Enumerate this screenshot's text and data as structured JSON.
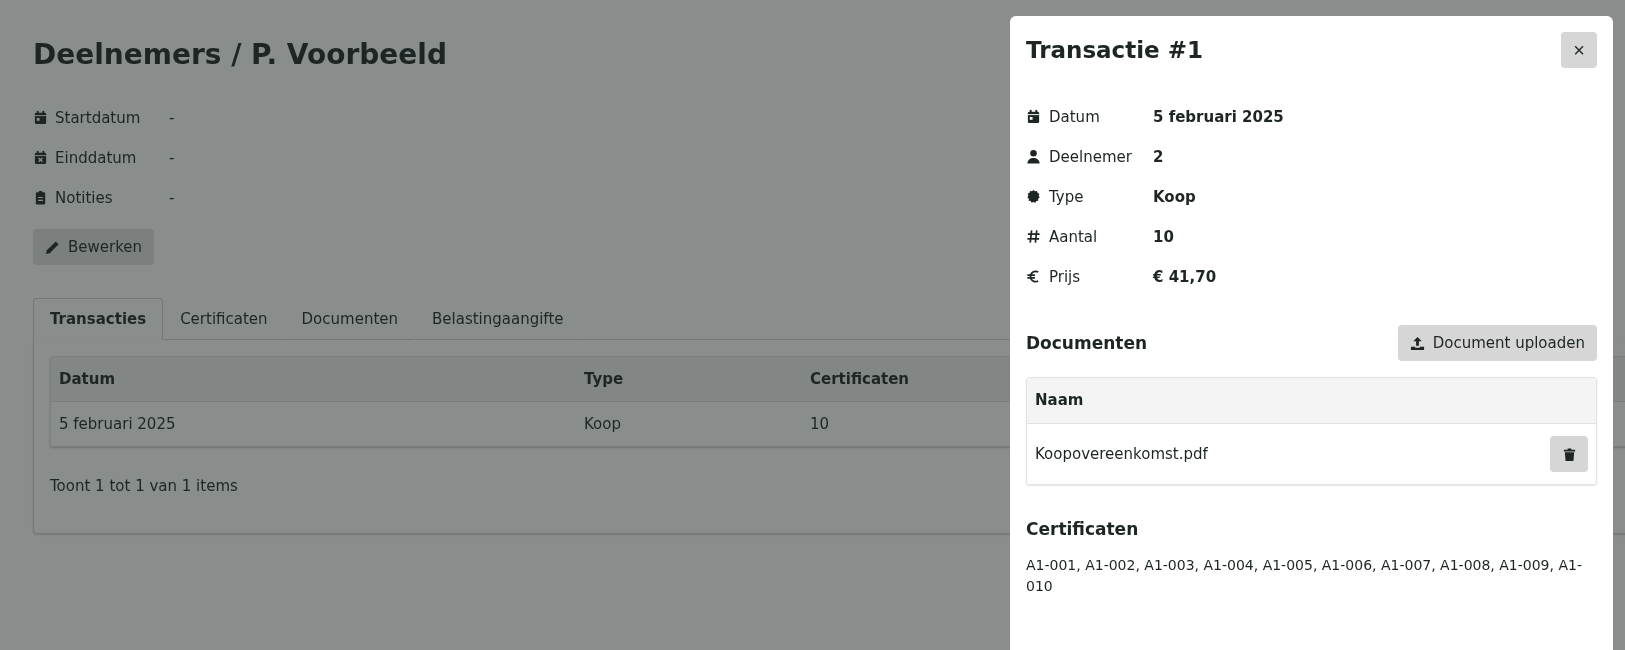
{
  "page": {
    "title": "Deelnemers / P. Voorbeeld",
    "details": [
      {
        "label": "Startdatum",
        "value": "-"
      },
      {
        "label": "Einddatum",
        "value": "-"
      },
      {
        "label": "Notities",
        "value": "-"
      }
    ],
    "edit_button": "Bewerken",
    "tabs": [
      {
        "label": "Transacties",
        "selected": true
      },
      {
        "label": "Certificaten",
        "selected": false
      },
      {
        "label": "Documenten",
        "selected": false
      },
      {
        "label": "Belastingaangifte",
        "selected": false
      }
    ],
    "table": {
      "columns": [
        "Datum",
        "Type",
        "Certificaten"
      ],
      "rows": [
        [
          "5 februari 2025",
          "Koop",
          "10"
        ]
      ]
    },
    "footer": "Toont 1 tot 1 van 1 items"
  },
  "drawer": {
    "title": "Transactie #1",
    "close": "×",
    "details": [
      {
        "label": "Datum",
        "value": "5 februari 2025"
      },
      {
        "label": "Deelnemer",
        "value": "2"
      },
      {
        "label": "Type",
        "value": "Koop"
      },
      {
        "label": "Aantal",
        "value": "10"
      },
      {
        "label": "Prijs",
        "value": "€ 41,70"
      }
    ],
    "documents": {
      "heading": "Documenten",
      "upload_button": "Document uploaden",
      "column": "Naam",
      "rows": [
        {
          "name": "Koopovereenkomst.pdf"
        }
      ]
    },
    "certificates": {
      "heading": "Certificaten",
      "text": "A1-001, A1-002, A1-003, A1-004, A1-005, A1-006, A1-007, A1-008, A1-009, A1-010"
    }
  }
}
